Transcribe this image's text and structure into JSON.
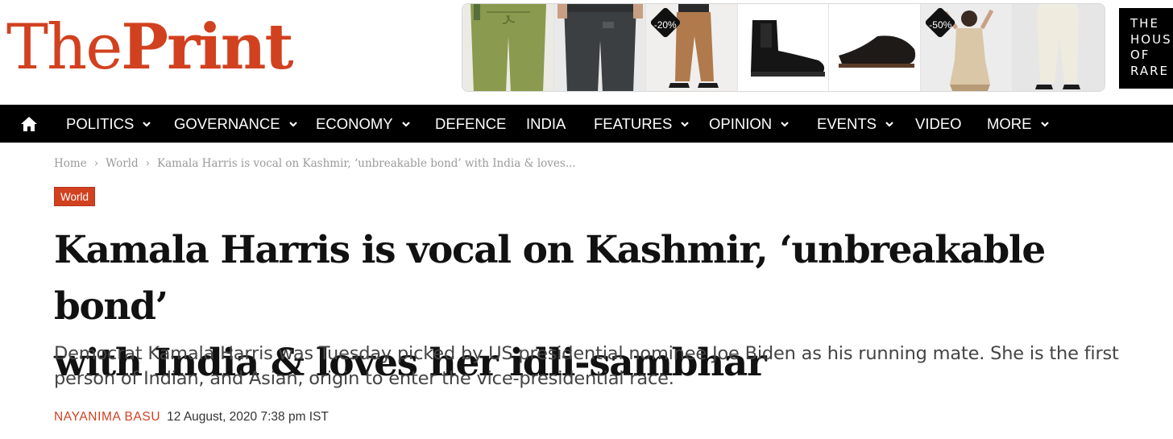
{
  "logo": {
    "part1": "The",
    "part2": "Print"
  },
  "ad": {
    "tiles": [
      {
        "name": "olive-trousers-tile",
        "badge": ""
      },
      {
        "name": "charcoal-trousers-tile",
        "badge": ""
      },
      {
        "name": "khaki-trousers-tile",
        "badge": "-20%"
      },
      {
        "name": "chelsea-boot-tile",
        "badge": ""
      },
      {
        "name": "black-mule-tile",
        "badge": ""
      },
      {
        "name": "beige-dress-tile",
        "badge": "-50%"
      },
      {
        "name": "cream-trousers-tile",
        "badge": ""
      }
    ],
    "brand_lines": [
      "THE",
      "HOUS",
      "OF",
      "RARE"
    ]
  },
  "nav": {
    "home_icon": "home-icon",
    "items": [
      {
        "label": "POLITICS",
        "dropdown": true
      },
      {
        "label": "GOVERNANCE",
        "dropdown": true
      },
      {
        "label": "ECONOMY",
        "dropdown": true
      },
      {
        "label": "DEFENCE",
        "dropdown": false
      },
      {
        "label": "INDIA",
        "dropdown": false
      },
      {
        "label": "FEATURES",
        "dropdown": true
      },
      {
        "label": "OPINION",
        "dropdown": true
      },
      {
        "label": "EVENTS",
        "dropdown": true
      },
      {
        "label": "VIDEO",
        "dropdown": false
      },
      {
        "label": "MORE",
        "dropdown": true
      }
    ]
  },
  "breadcrumb": {
    "home": "Home",
    "separator": "›",
    "section": "World",
    "current": "Kamala Harris is vocal on Kashmir, ‘unbreakable bond’ with India & loves..."
  },
  "article": {
    "category": "World",
    "headline_line1": "Kamala Harris is vocal on Kashmir, ‘unbreakable bond’",
    "headline_line2": "with India & loves her idli-sambhar",
    "dek": "Democrat Kamala Harris was Tuesday picked by US presidential nominee Joe Biden as his running mate. She is the first person of Indian, and Asian, origin to enter the vice-presidential race.",
    "author": "NAYANIMA BASU",
    "date": "12 August, 2020 7:38 pm IST"
  },
  "colors": {
    "brand_red": "#d2411f",
    "nav_background": "#000000",
    "text_dark": "#111111",
    "text_muted": "#9a9a9a"
  }
}
